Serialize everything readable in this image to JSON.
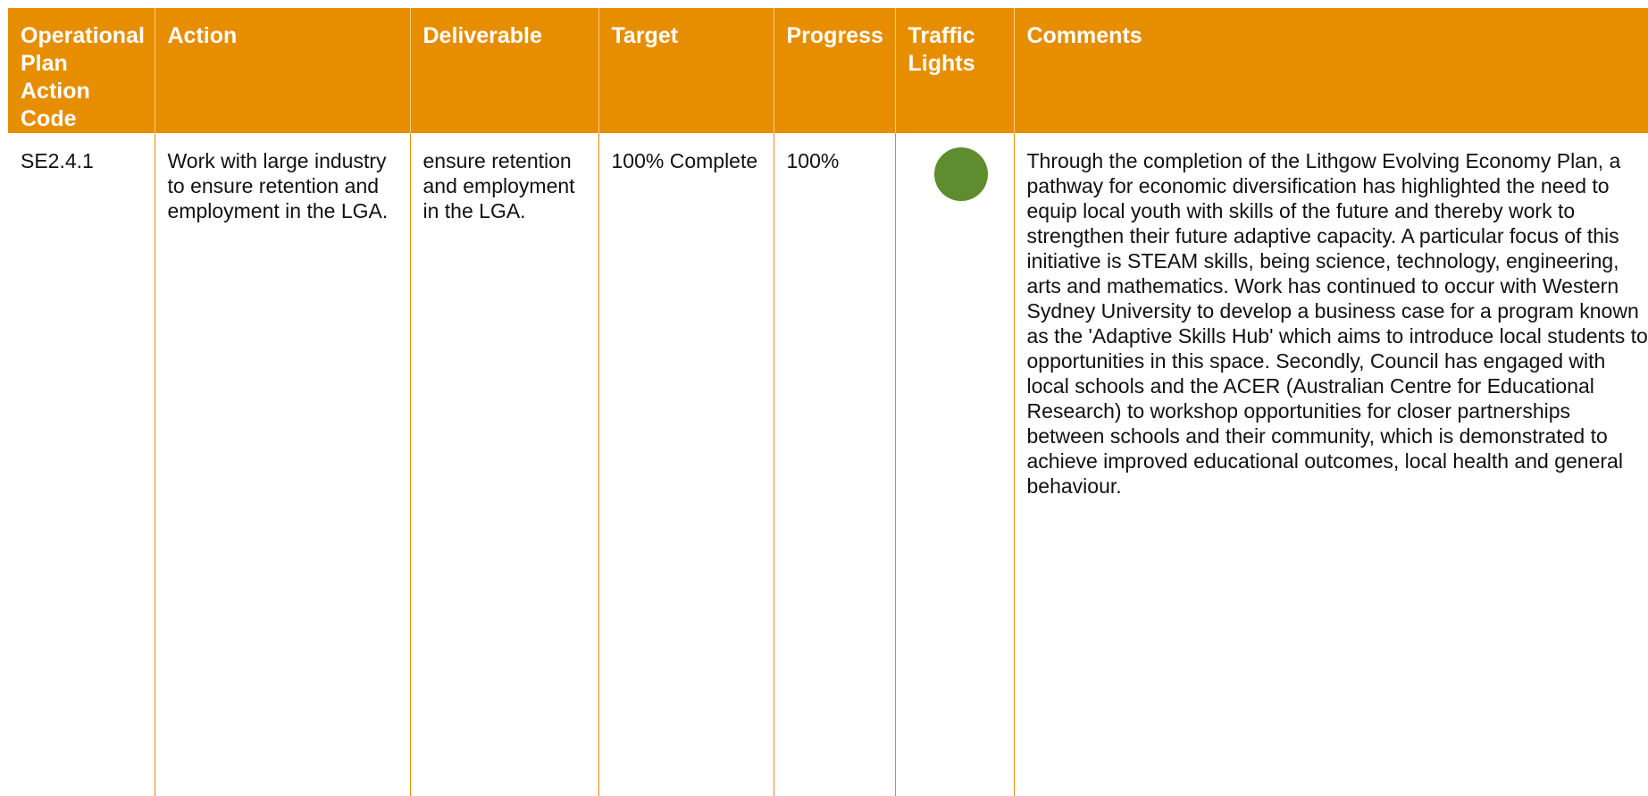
{
  "colors": {
    "header_background": "#e78e00",
    "header_text": "#ffffff",
    "grid_lines": "#e78e00",
    "traffic_light_green": "#5e8c2f"
  },
  "headers": {
    "code": "Operational Plan Action Code",
    "action": "Action",
    "deliverable": "Deliverable",
    "target": "Target",
    "progress": "Progress",
    "traffic_lights": "Traffic Lights",
    "comments": "Comments"
  },
  "row": {
    "code": "SE2.4.1",
    "action": "Work with large industry to ensure retention and employment in the LGA.",
    "deliverable": "ensure retention and employment in the LGA.",
    "target": "100% Complete",
    "progress": "100%",
    "traffic_light_status": "green",
    "comments": "Through the completion of the Lithgow Evolving Economy Plan, a pathway for economic diversification has highlighted the need to equip local youth with skills of the future and thereby work to strengthen their future adaptive capacity. A particular focus of this initiative is STEAM skills, being science, technology, engineering, arts and mathematics. Work has continued to occur with Western Sydney University to develop a business case for a program known as the 'Adaptive Skills Hub' which aims to introduce local students to opportunities in this space. Secondly, Council has engaged with local schools and the ACER (Australian Centre for Educational Research) to workshop opportunities for closer partnerships between schools and their community, which is demonstrated to achieve improved educational outcomes, local health and general behaviour."
  }
}
